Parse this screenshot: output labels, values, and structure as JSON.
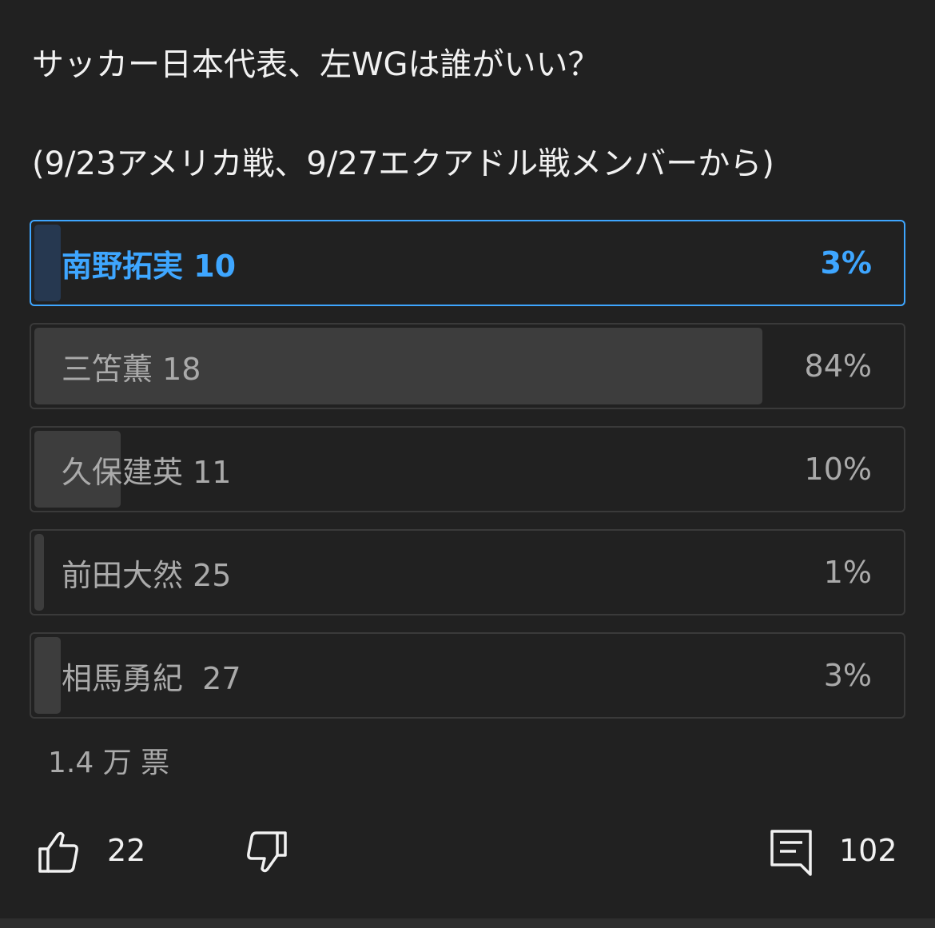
{
  "post": {
    "line1": "サッカー日本代表、左WGは誰がいい？",
    "line2": "(9/23アメリカ戦、9/27エクアドル戦メンバーから)"
  },
  "poll": {
    "options": [
      {
        "label": "南野拓実 10",
        "percent_text": "3%",
        "percent": 3,
        "selected": true
      },
      {
        "label": "三笘薫 18",
        "percent_text": "84%",
        "percent": 84,
        "selected": false
      },
      {
        "label": "久保建英 11",
        "percent_text": "10%",
        "percent": 10,
        "selected": false
      },
      {
        "label": "前田大然 25",
        "percent_text": "1%",
        "percent": 1,
        "selected": false
      },
      {
        "label": "相馬勇紀  27",
        "percent_text": "3%",
        "percent": 3,
        "selected": false
      }
    ],
    "vote_count": "1.4 万 票"
  },
  "actions": {
    "like_icon": "thumbs-up-icon",
    "like_count": "22",
    "dislike_icon": "thumbs-down-icon",
    "comment_icon": "comment-icon",
    "comment_count": "102"
  },
  "colors": {
    "background": "#212121",
    "accent": "#3ea6ff",
    "option_border": "#3a3a3a",
    "fill": "#3d3d3d",
    "selected_fill": "#263850",
    "muted_text": "#aaaaaa"
  }
}
